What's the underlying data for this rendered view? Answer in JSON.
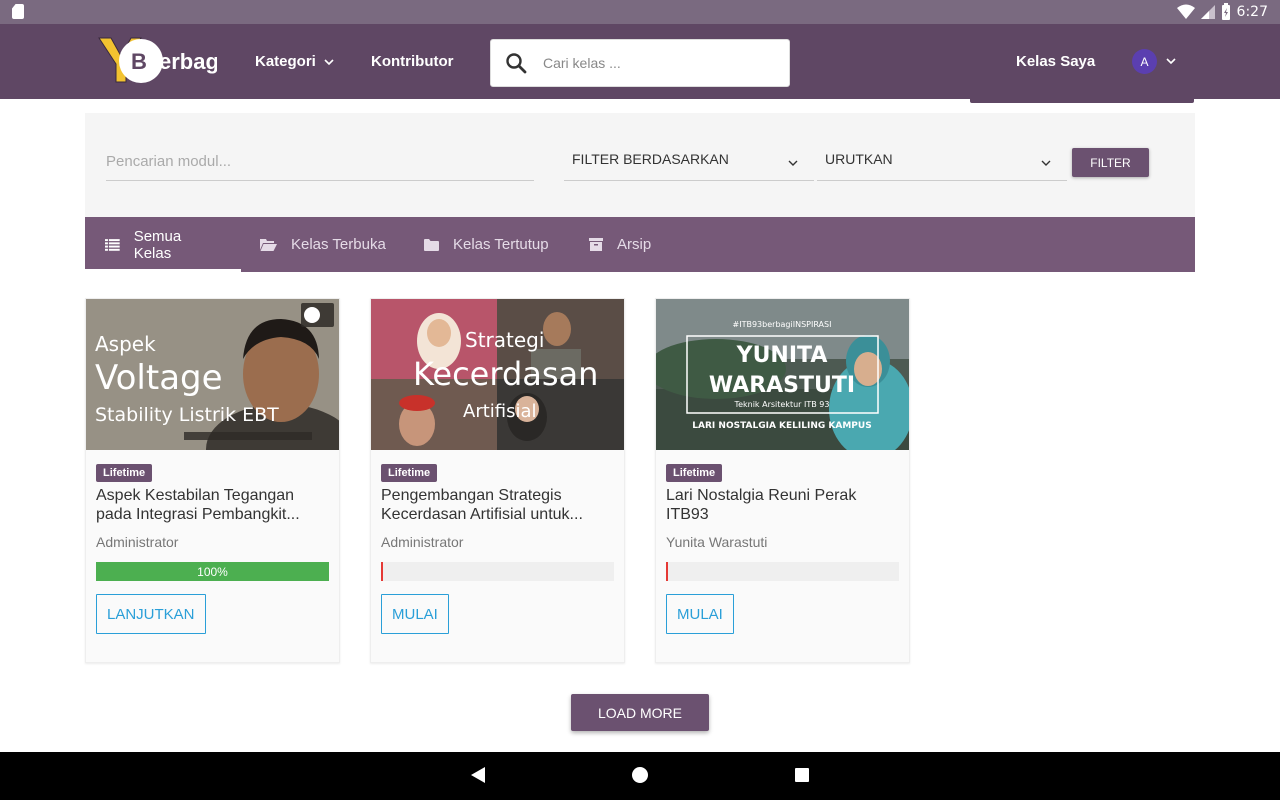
{
  "status_bar": {
    "time": "6:27"
  },
  "header": {
    "logo_text": "YBerbagi",
    "nav": {
      "category": "Kategori",
      "contributor": "Kontributor",
      "my_classes": "Kelas Saya"
    },
    "search_placeholder": "Cari kelas ...",
    "avatar_initial": "A"
  },
  "filters": {
    "module_search_placeholder": "Pencarian modul...",
    "filter_by": "FILTER BERDASARKAN",
    "sort": "URUTKAN",
    "filter_button": "FILTER"
  },
  "tabs": [
    {
      "label": "Semua Kelas",
      "icon": "list-icon",
      "active": true
    },
    {
      "label": "Kelas Terbuka",
      "icon": "folder-open-icon",
      "active": false
    },
    {
      "label": "Kelas Tertutup",
      "icon": "folder-icon",
      "active": false
    },
    {
      "label": "Arsip",
      "icon": "archive-icon",
      "active": false
    }
  ],
  "courses": [
    {
      "badge": "Lifetime",
      "title": "Aspek Kestabilan Tegangan pada Integrasi Pembangkit...",
      "author": "Administrator",
      "progress": 100,
      "progress_label": "100%",
      "action": "LANJUTKAN",
      "thumb": {
        "line1": "Aspek",
        "line2": "Voltage",
        "line3": "Stability Listrik EBT"
      }
    },
    {
      "badge": "Lifetime",
      "title": "Pengembangan Strategis Kecerdasan Artifisial untuk...",
      "author": "Administrator",
      "progress": 0,
      "progress_label": "",
      "action": "MULAI",
      "thumb": {
        "line1": "Strategi",
        "line2": "Kecerdasan",
        "line3": "Artifisial"
      }
    },
    {
      "badge": "Lifetime",
      "title": "Lari Nostalgia Reuni Perak ITB93",
      "author": "Yunita Warastuti",
      "progress": 0,
      "progress_label": "",
      "action": "MULAI",
      "thumb": {
        "tag": "#ITB93berbagiINSPIRASI",
        "line1": "YUNITA",
        "line2": "WARASTUTI",
        "line3": "Teknik Arsitektur ITB 93",
        "line4": "LARI NOSTALGIA KELILING KAMPUS"
      }
    }
  ],
  "load_more": "LOAD MORE",
  "colors": {
    "primary": "#5f4764",
    "tab_bar": "#765978",
    "accent_link": "#2a9fd8",
    "progress_green": "#4caf50"
  }
}
